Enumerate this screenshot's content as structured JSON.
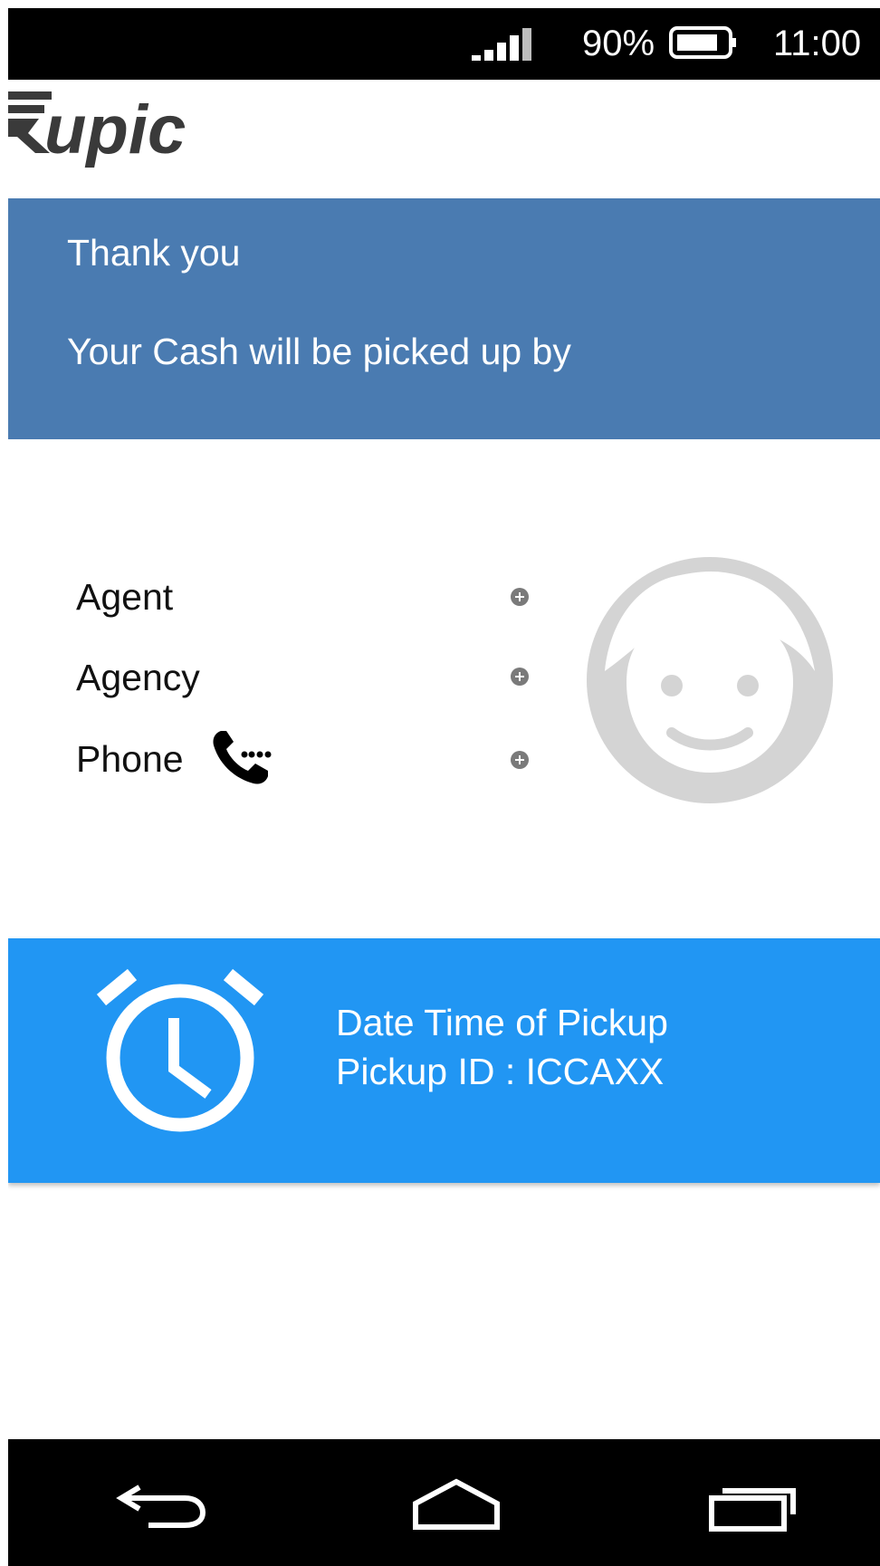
{
  "status_bar": {
    "battery_percent": "90%",
    "time": "11:00",
    "icons": [
      "signal-icon",
      "battery-icon"
    ]
  },
  "logo": {
    "text": "Rupic"
  },
  "banner": {
    "line1": "Thank you",
    "line2": "Your Cash will be picked up by",
    "color": "#4a7bb1"
  },
  "agent_info": {
    "rows": [
      {
        "label": "Agent"
      },
      {
        "label": "Agency"
      },
      {
        "label": "Phone"
      }
    ],
    "icons": [
      "phone-icon",
      "add-icon",
      "avatar-icon"
    ]
  },
  "pickup": {
    "line1": "Date Time of Pickup",
    "line2": "Pickup ID : ICCAXX",
    "color": "#2196f3",
    "icon": "alarm-clock-icon"
  },
  "nav_bar": {
    "buttons": [
      "back-icon",
      "home-icon",
      "recents-icon"
    ]
  }
}
